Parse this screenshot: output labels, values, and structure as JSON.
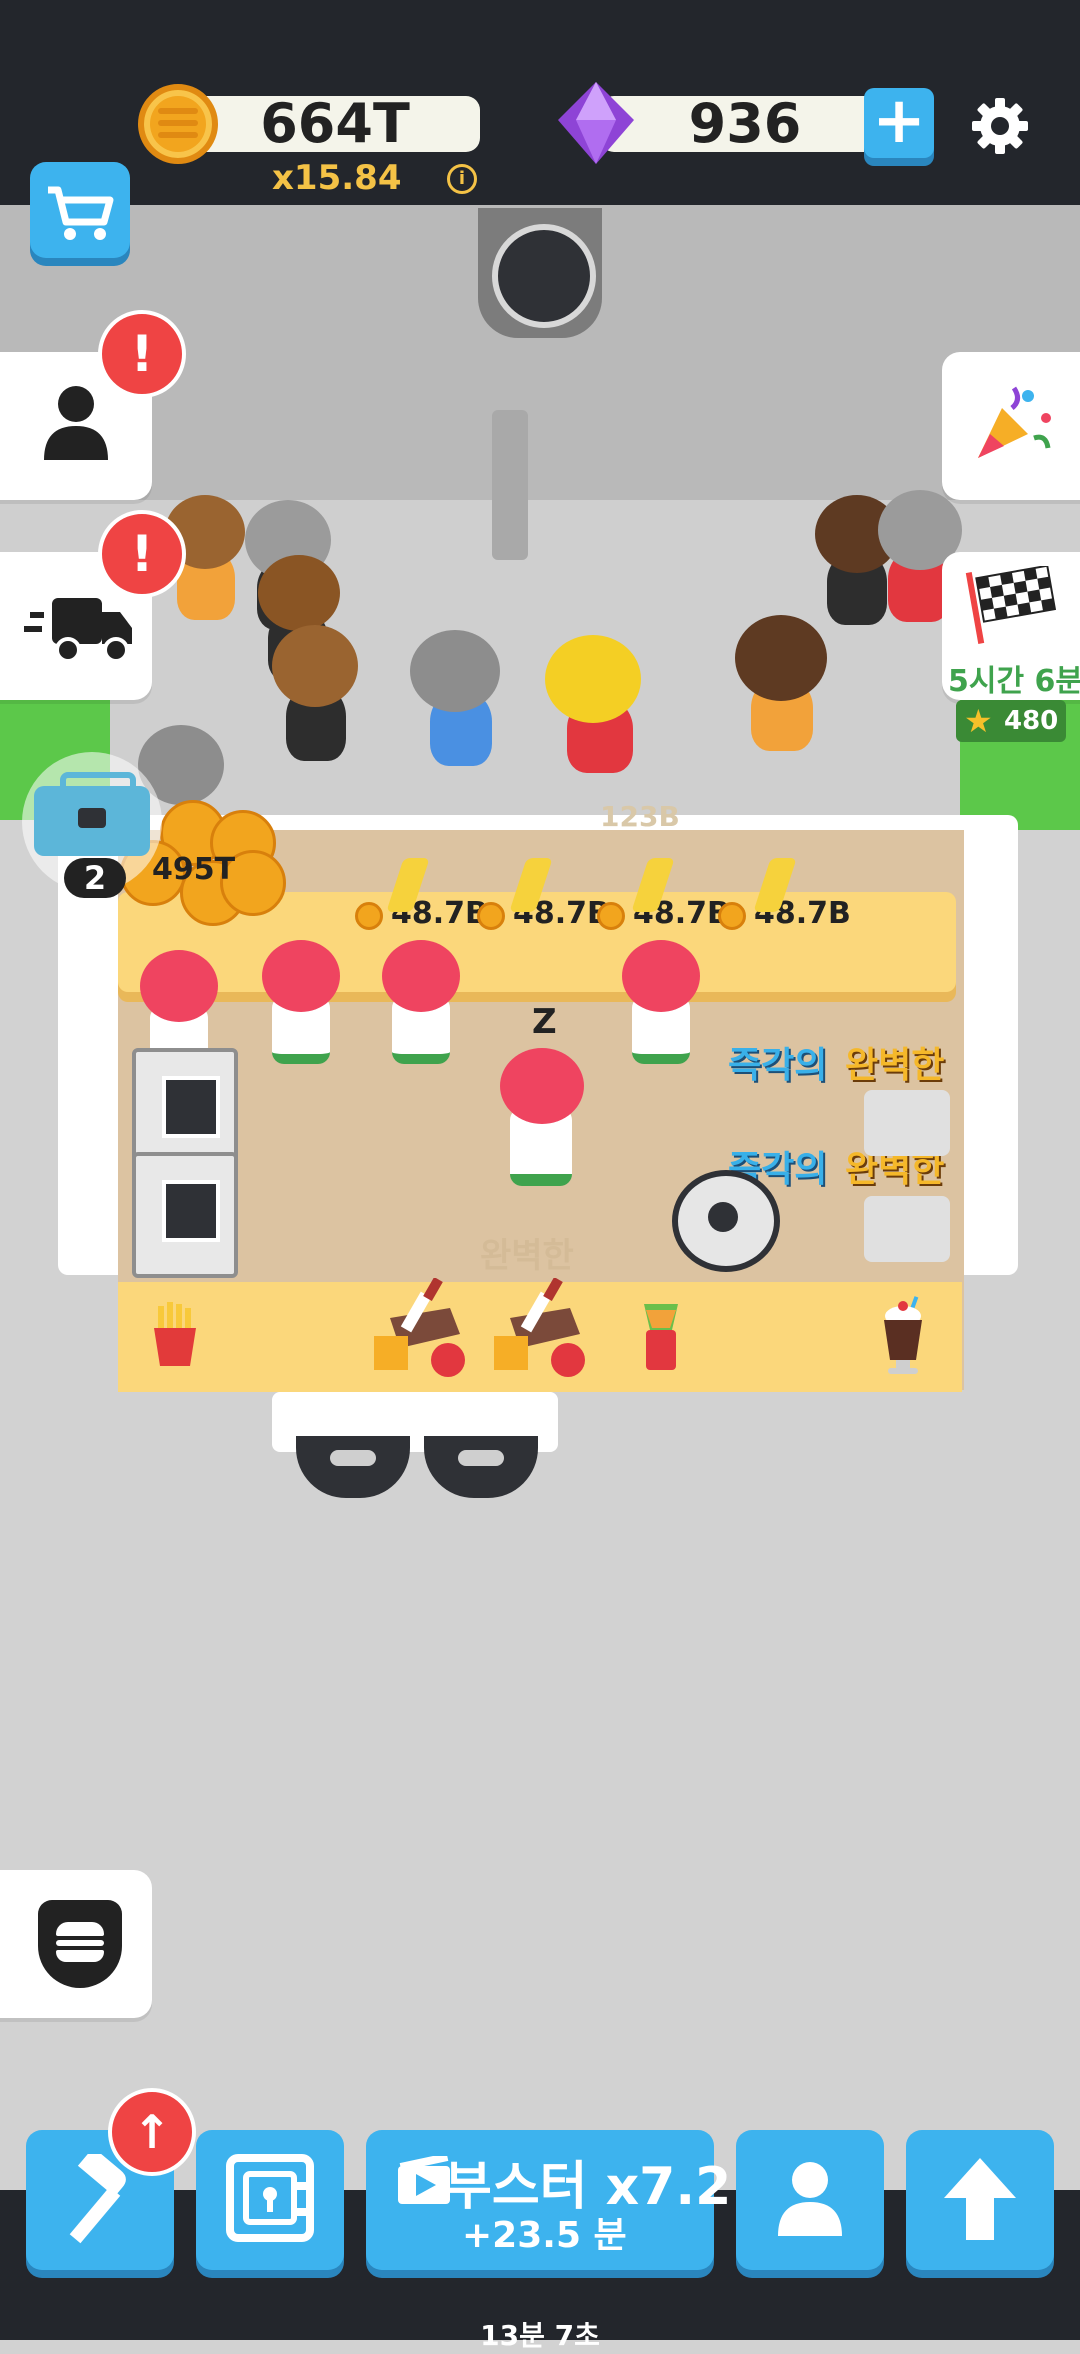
{
  "hud": {
    "coins": "664T",
    "multiplier": "x15.84",
    "info_icon": "i",
    "gems": "936",
    "plus_label": "+",
    "settings_icon": "gear-icon"
  },
  "side_left": {
    "profile_icon": "person-icon",
    "profile_badge": "!",
    "delivery_icon": "delivery-truck-icon",
    "delivery_badge": "!",
    "toolbox_count": "2",
    "coin_pile_value": "495T",
    "menu_icon": "burger-icon"
  },
  "side_right": {
    "event_icon": "party-popper-icon",
    "race_icon": "checkered-flag-icon",
    "race_timer": "5시간 6분",
    "race_stars": "480"
  },
  "world": {
    "faded_value": "123B",
    "counter_prices": [
      "48.7B",
      "48.7B",
      "48.7B",
      "48.7B"
    ],
    "sleep_z": "Z",
    "bubble_1a": "즉각의",
    "bubble_1b": "완벽한",
    "bubble_2a": "즉각의",
    "bubble_2b": "완벽한",
    "floor_text": "완벽한"
  },
  "bottom": {
    "build_icon": "hammer-icon",
    "build_badge": "↑",
    "vault_icon": "safe-icon",
    "booster_label": "부스터 x7.2",
    "booster_sub": "+23.5 분",
    "staff_icon": "person-icon",
    "upgrade_icon": "arrow-up-icon",
    "timer": "13분 7초"
  },
  "colors": {
    "accent_blue": "#3db3ee",
    "badge_red": "#ef4444",
    "counter_yellow": "#fbd77b",
    "floor_wood": "#dcc3a1",
    "hud_dark": "#23262c"
  }
}
